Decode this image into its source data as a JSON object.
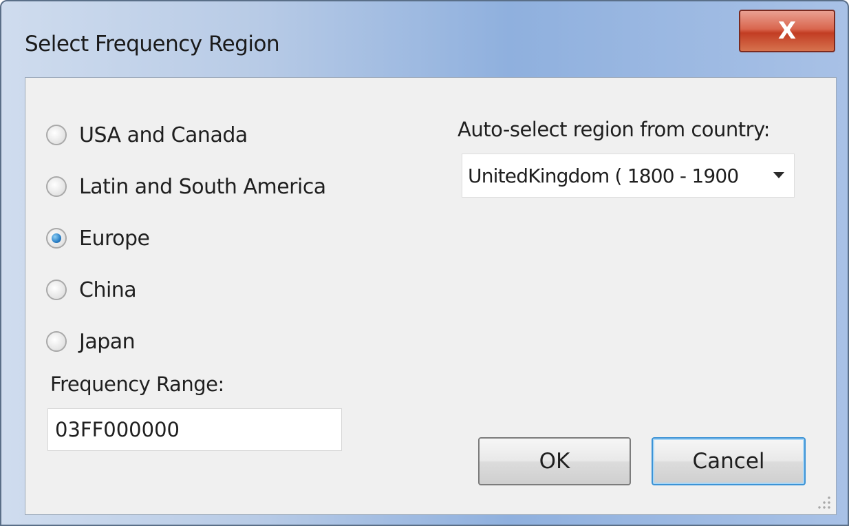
{
  "window": {
    "title": "Select Frequency Region",
    "close_glyph": "X"
  },
  "regions": {
    "selected": "Europe",
    "options": [
      {
        "label": "USA and Canada",
        "checked": false
      },
      {
        "label": "Latin and South America",
        "checked": false
      },
      {
        "label": "Europe",
        "checked": true
      },
      {
        "label": "China",
        "checked": false
      },
      {
        "label": "Japan",
        "checked": false
      }
    ]
  },
  "frequency_range": {
    "label": "Frequency Range:",
    "value": "03FF000000"
  },
  "auto_select": {
    "label": "Auto-select region from country:",
    "selected_value": "UnitedKingdom ( 1800 - 1900"
  },
  "buttons": {
    "ok_label": "OK",
    "cancel_label": "Cancel"
  },
  "colors": {
    "titlebar_accent": "#8fb0de",
    "close_button": "#c23d23",
    "client_background": "#f0f0f0",
    "focus_border": "#3c93d6"
  }
}
